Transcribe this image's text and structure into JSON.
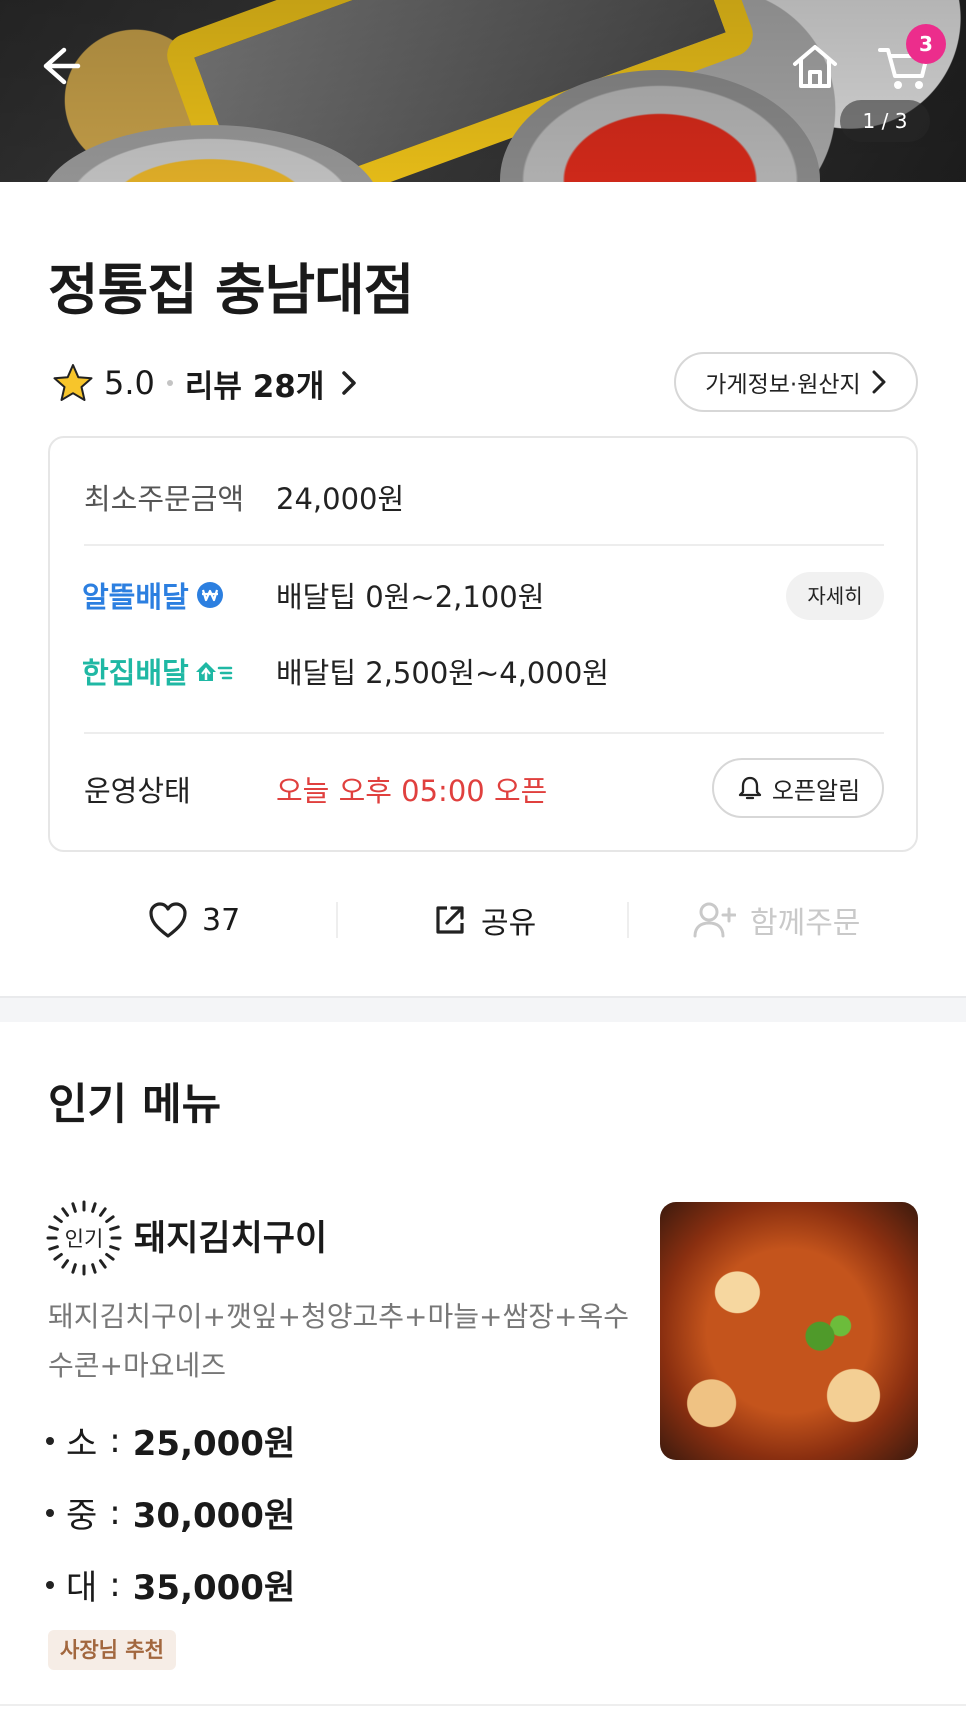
{
  "header": {
    "photo_counter": "1 / 3",
    "cart_count": "3",
    "icons": [
      "back-arrow-icon",
      "home-icon",
      "cart-icon"
    ]
  },
  "store": {
    "name": "정통집 충남대점",
    "rating": "5.0",
    "review_label": "리뷰 28개",
    "info_button": "가게정보·원산지"
  },
  "info": {
    "min_order_label": "최소주문금액",
    "min_order_value": "24,000원",
    "delivery_options": [
      {
        "name": "알뜰배달",
        "tip": "배달팁 0원~2,100원",
        "color": "#2c7fe0"
      },
      {
        "name": "한집배달",
        "tip": "배달팁 2,500원~4,000원",
        "color": "#1fb8a4"
      }
    ],
    "detail_button": "자세히",
    "status_label": "운영상태",
    "status_value": "오늘 오후 05:00 오픈",
    "status_color": "#e0403e",
    "alarm_button": "오픈알림"
  },
  "actions": {
    "like_count": "37",
    "share_label": "공유",
    "group_order_label": "함께주문"
  },
  "popular": {
    "title": "인기 메뉴",
    "badge": "인기",
    "item": {
      "name": "돼지김치구이",
      "description": "돼지김치구이+깻잎+청양고추+마늘+쌈장+옥수수콘+마요네즈",
      "prices": [
        {
          "size": "소",
          "price": "25,000원"
        },
        {
          "size": "중",
          "price": "30,000원"
        },
        {
          "size": "대",
          "price": "35,000원"
        }
      ],
      "tag": "사장님 추천"
    }
  }
}
